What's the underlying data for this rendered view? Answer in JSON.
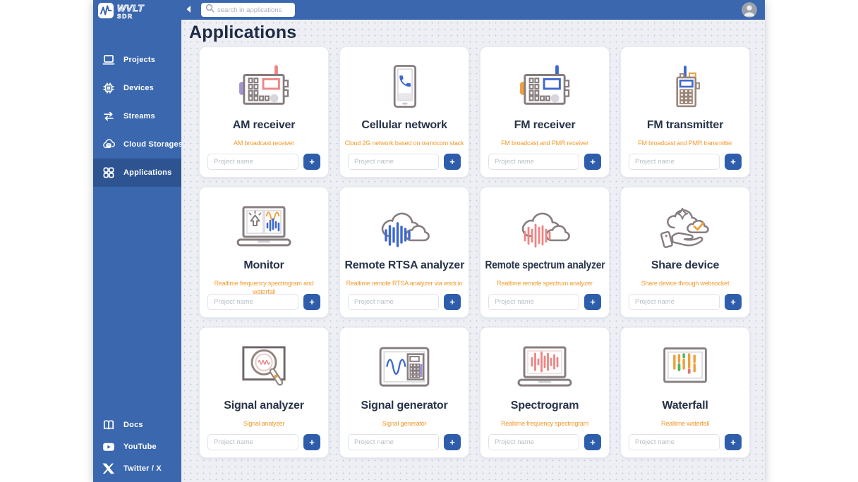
{
  "brand": {
    "name": "WVLT",
    "sub": "SDR"
  },
  "topbar": {
    "search_placeholder": "search in applications"
  },
  "sidebar": {
    "items": [
      {
        "label": "Projects",
        "icon": "laptop",
        "active": false
      },
      {
        "label": "Devices",
        "icon": "chip",
        "active": false
      },
      {
        "label": "Streams",
        "icon": "arrows",
        "active": false
      },
      {
        "label": "Cloud Storages",
        "icon": "cloud-storage",
        "active": false
      },
      {
        "label": "Applications",
        "icon": "apps-grid",
        "active": true
      }
    ],
    "footer_items": [
      {
        "label": "Docs",
        "icon": "book"
      },
      {
        "label": "YouTube",
        "icon": "youtube"
      },
      {
        "label": "Twitter / X",
        "icon": "x-logo"
      }
    ]
  },
  "main": {
    "title": "Applications",
    "cards": [
      {
        "title": "AM receiver",
        "subtitle": "AM broadcast receiver",
        "icon": "am-radio",
        "input_placeholder": "Project name",
        "add_label": "+"
      },
      {
        "title": "Cellular network",
        "subtitle": "Cloud 2G network based on osmocom stack",
        "icon": "cell-phone",
        "input_placeholder": "Project name",
        "add_label": "+"
      },
      {
        "title": "FM receiver",
        "subtitle": "FM broadcast and PMR receiver",
        "icon": "fm-radio",
        "input_placeholder": "Project name",
        "add_label": "+"
      },
      {
        "title": "FM transmitter",
        "subtitle": "FM broadcast and PMR transmitter",
        "icon": "walkie-talkie",
        "input_placeholder": "Project name",
        "add_label": "+"
      },
      {
        "title": "Monitor",
        "subtitle": "Realtime frequency spectrogram and waterfall",
        "icon": "monitor-laptop",
        "input_placeholder": "Project name",
        "add_label": "+"
      },
      {
        "title": "Remote RTSA analyzer",
        "subtitle": "Realtime remote RTSA analyzer via wsdr.io",
        "icon": "cloud-bars-blue",
        "input_placeholder": "Project name",
        "add_label": "+"
      },
      {
        "title": "Remote spectrum analyzer",
        "subtitle": "Realtime remote spectrum analyzer",
        "icon": "cloud-bars-red",
        "input_placeholder": "Project name",
        "add_label": "+"
      },
      {
        "title": "Share device",
        "subtitle": "Share device through websocket",
        "icon": "share-hand",
        "input_placeholder": "Project name",
        "add_label": "+"
      },
      {
        "title": "Signal analyzer",
        "subtitle": "Signal analyzer",
        "icon": "magnifier-wave",
        "input_placeholder": "Project name",
        "add_label": "+"
      },
      {
        "title": "Signal generator",
        "subtitle": "Signal generator",
        "icon": "signal-generator",
        "input_placeholder": "Project name",
        "add_label": "+"
      },
      {
        "title": "Spectrogram",
        "subtitle": "Realtime frequency spectrogram",
        "icon": "spectrogram-laptop",
        "input_placeholder": "Project name",
        "add_label": "+"
      },
      {
        "title": "Waterfall",
        "subtitle": "Realtime waterfall",
        "icon": "waterfall-screen",
        "input_placeholder": "Project name",
        "add_label": "+"
      }
    ]
  },
  "colors": {
    "sidebar_blue": "#3a67ae",
    "sidebar_active_blue": "#2d5391",
    "subtitle_orange": "#f49a2e",
    "button_blue": "#2e5dab",
    "page_background": "#edeff5"
  }
}
